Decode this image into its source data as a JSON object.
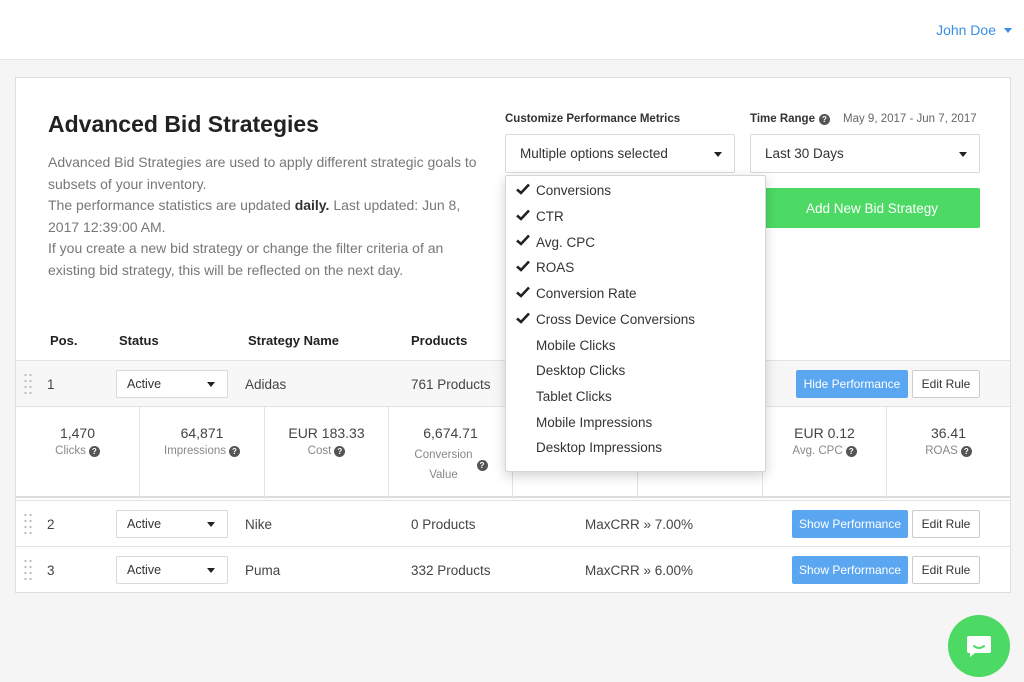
{
  "header": {
    "user_name": "John Doe"
  },
  "page": {
    "title": "Advanced Bid Strategies",
    "desc_line1": "Advanced Bid Strategies are used to apply different strategic goals to subsets of your inventory.",
    "desc_line2_pre": "The performance statistics are updated ",
    "desc_line2_bold": "daily.",
    "desc_line2_post": " Last updated: Jun 8, 2017 12:39:00 AM.",
    "desc_line3": "If you create a new bid strategy or change the filter criteria of an existing bid strategy, this will be reflected on the next day."
  },
  "controls": {
    "metrics_label": "Customize Performance Metrics",
    "metrics_value": "Multiple options selected",
    "time_label": "Time Range",
    "date_range": "May 9, 2017 - Jun 7, 2017",
    "time_value": "Last 30 Days",
    "add_button": "Add New Bid Strategy"
  },
  "metric_options": [
    {
      "label": "Conversions",
      "checked": true
    },
    {
      "label": "CTR",
      "checked": true
    },
    {
      "label": "Avg. CPC",
      "checked": true
    },
    {
      "label": "ROAS",
      "checked": true
    },
    {
      "label": "Conversion Rate",
      "checked": true
    },
    {
      "label": "Cross Device Conversions",
      "checked": true
    },
    {
      "label": "Mobile Clicks",
      "checked": false
    },
    {
      "label": "Desktop Clicks",
      "checked": false
    },
    {
      "label": "Tablet Clicks",
      "checked": false
    },
    {
      "label": "Mobile Impressions",
      "checked": false
    },
    {
      "label": "Desktop Impressions",
      "checked": false
    }
  ],
  "table": {
    "headers": {
      "pos": "Pos.",
      "status": "Status",
      "name": "Strategy Name",
      "products": "Products"
    },
    "rows": [
      {
        "pos": "1",
        "status": "Active",
        "name": "Adidas",
        "products": "761 Products",
        "rule": "",
        "perf_button": "Hide Performance",
        "edit_button": "Edit Rule"
      },
      {
        "pos": "2",
        "status": "Active",
        "name": "Nike",
        "products": "0 Products",
        "rule": "MaxCRR » 7.00%",
        "perf_button": "Show Performance",
        "edit_button": "Edit Rule"
      },
      {
        "pos": "3",
        "status": "Active",
        "name": "Puma",
        "products": "332 Products",
        "rule": "MaxCRR » 6.00%",
        "perf_button": "Show Performance",
        "edit_button": "Edit Rule"
      }
    ]
  },
  "performance": [
    {
      "value": "1,470",
      "label": "Clicks"
    },
    {
      "value": "64,871",
      "label": "Impressions"
    },
    {
      "value": "EUR 183.33",
      "label": "Cost"
    },
    {
      "value": "6,674.71",
      "label": "Conversion Value"
    },
    {
      "value": "EUR 0.12",
      "label": "Avg. CPC"
    },
    {
      "value": "36.41",
      "label": "ROAS"
    }
  ],
  "colors": {
    "accent_blue": "#5aa6f0",
    "accent_green": "#4cd964",
    "link_blue": "#3a8ee6"
  },
  "icons": {
    "help": "question-circle-icon",
    "check": "checkmark-icon",
    "chat": "chat-bubble-icon",
    "drag": "drag-handle-icon"
  }
}
